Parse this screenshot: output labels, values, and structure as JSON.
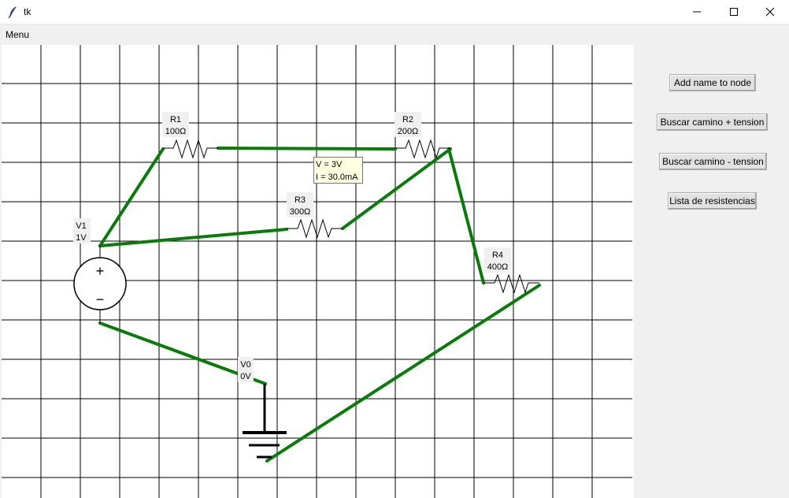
{
  "window": {
    "title": "tk"
  },
  "menubar": {
    "items": [
      {
        "label": "Menu"
      }
    ]
  },
  "sidebar": {
    "buttons": [
      {
        "label": "Add name to node"
      },
      {
        "label": "Buscar camino + tension"
      },
      {
        "label": "Buscar camino - tension"
      },
      {
        "label": "Lista de resistencias"
      }
    ]
  },
  "circuit": {
    "wire_color": "#0a7a0a",
    "sources": [
      {
        "name": "V1",
        "value": "1V",
        "plus": "+",
        "minus": "−"
      }
    ],
    "grounds": [
      {
        "name": "V0",
        "value": "0V"
      }
    ],
    "resistors": [
      {
        "name": "R1",
        "value": "100Ω"
      },
      {
        "name": "R2",
        "value": "200Ω"
      },
      {
        "name": "R3",
        "value": "300Ω"
      },
      {
        "name": "R4",
        "value": "400Ω"
      }
    ],
    "tooltip": {
      "line1": "V = 3V",
      "line2": "I = 30.0mA"
    }
  }
}
